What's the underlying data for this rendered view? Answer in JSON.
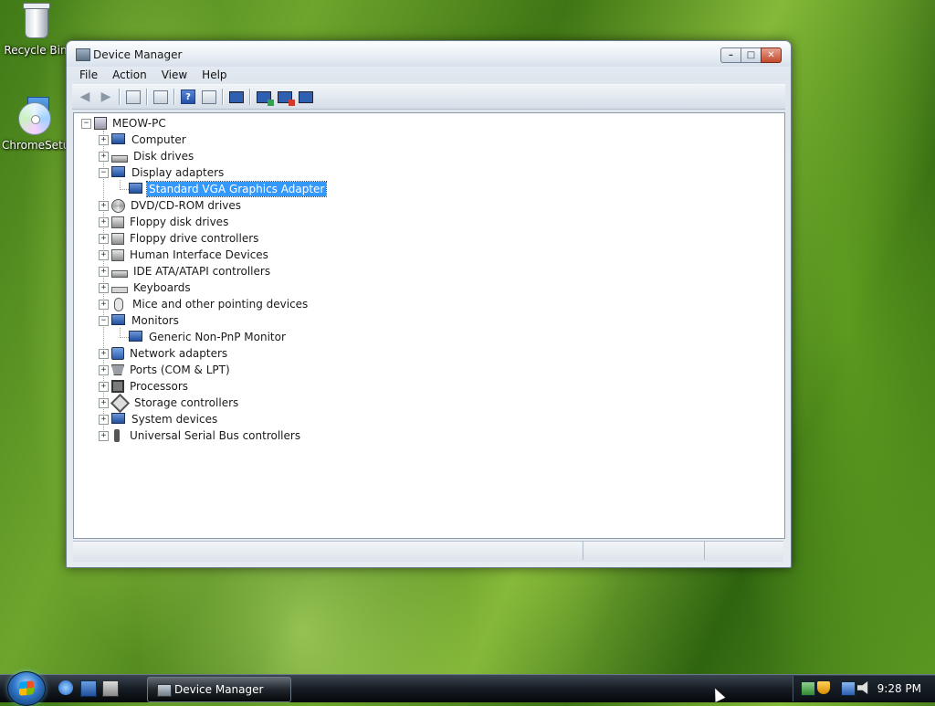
{
  "desktop": {
    "icons": [
      {
        "label": "Recycle Bin"
      },
      {
        "label": "ChromeSetup"
      }
    ]
  },
  "window": {
    "title": "Device Manager",
    "caption_buttons": {
      "minimize": "–",
      "maximize": "□",
      "close": "✕"
    },
    "menu": [
      "File",
      "Action",
      "View",
      "Help"
    ],
    "toolbar": {
      "back": "back-arrow-icon",
      "forward": "forward-arrow-icon",
      "help_glyph": "?"
    },
    "tree": {
      "root": "MEOW-PC",
      "items": [
        {
          "label": "Computer",
          "expanded": false
        },
        {
          "label": "Disk drives",
          "expanded": false
        },
        {
          "label": "Display adapters",
          "expanded": true,
          "children": [
            "Standard VGA Graphics Adapter"
          ]
        },
        {
          "label": "DVD/CD-ROM drives",
          "expanded": false
        },
        {
          "label": "Floppy disk drives",
          "expanded": false
        },
        {
          "label": "Floppy drive controllers",
          "expanded": false
        },
        {
          "label": "Human Interface Devices",
          "expanded": false
        },
        {
          "label": "IDE ATA/ATAPI controllers",
          "expanded": false
        },
        {
          "label": "Keyboards",
          "expanded": false
        },
        {
          "label": "Mice and other pointing devices",
          "expanded": false
        },
        {
          "label": "Monitors",
          "expanded": true,
          "children": [
            "Generic Non-PnP Monitor"
          ]
        },
        {
          "label": "Network adapters",
          "expanded": false
        },
        {
          "label": "Ports (COM & LPT)",
          "expanded": false
        },
        {
          "label": "Processors",
          "expanded": false
        },
        {
          "label": "Storage controllers",
          "expanded": false
        },
        {
          "label": "System devices",
          "expanded": false
        },
        {
          "label": "Universal Serial Bus controllers",
          "expanded": false
        }
      ],
      "selected": "Standard VGA Graphics Adapter",
      "expand_glyph": "+",
      "collapse_glyph": "−"
    }
  },
  "taskbar": {
    "task_button": "Device Manager",
    "clock": "9:28 PM"
  }
}
